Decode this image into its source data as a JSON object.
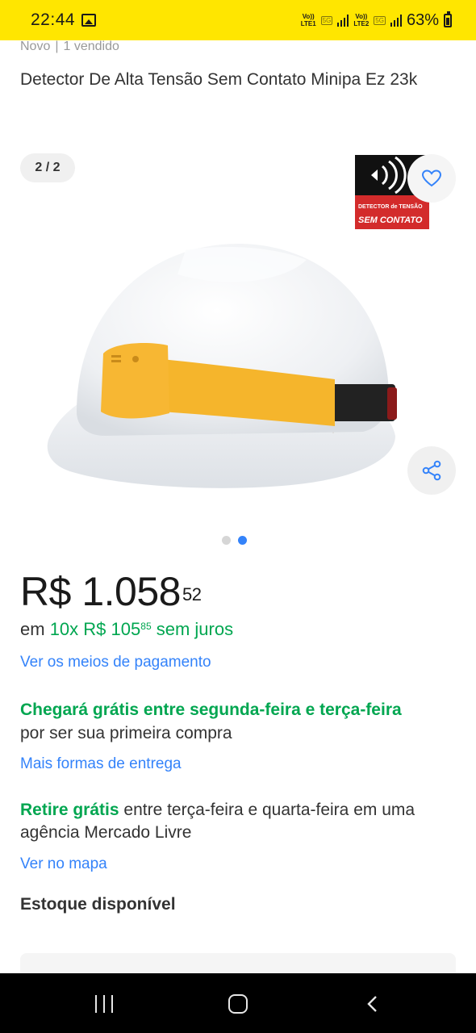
{
  "status_bar": {
    "time": "22:44",
    "sim1_line1": "Vo))",
    "sim1_line2": "LTE1",
    "sim1_network": "5G",
    "sim2_line1": "Vo))",
    "sim2_line2": "LTE2",
    "sim2_network": "5G",
    "battery": "63%"
  },
  "product": {
    "condition": "Novo",
    "separator": "|",
    "sold": "1 vendido",
    "title": "Detector De Alta Tensão Sem Contato Minipa Ez 23k"
  },
  "gallery": {
    "counter": "2 / 2",
    "current_image": 2,
    "total_images": 2,
    "logo_text_line1": "DETECTOR de TENSÃO",
    "logo_text_line2": "SEM CONTATO"
  },
  "price": {
    "currency": "R$",
    "integer": "1.058",
    "cents": "52"
  },
  "installments": {
    "prefix": "em",
    "count": "10x",
    "currency": "R$",
    "integer": "105",
    "cents": "85",
    "suffix": "sem juros"
  },
  "links": {
    "payment": "Ver os meios de pagamento",
    "delivery": "Mais formas de entrega",
    "map": "Ver no mapa"
  },
  "shipping": {
    "title": "Chegará grátis entre segunda-feira e terça-feira",
    "subtitle": "por ser sua primeira compra"
  },
  "pickup": {
    "highlight": "Retire grátis",
    "text": "entre terça-feira e quarta-feira em uma agência Mercado Livre"
  },
  "stock": {
    "label": "Estoque disponível"
  },
  "colors": {
    "header_yellow": "#ffe600",
    "accent_blue": "#3483fa",
    "success_green": "#00a650",
    "helmet_white": "#f4f5f7",
    "strap_yellow": "#f5b52c"
  }
}
